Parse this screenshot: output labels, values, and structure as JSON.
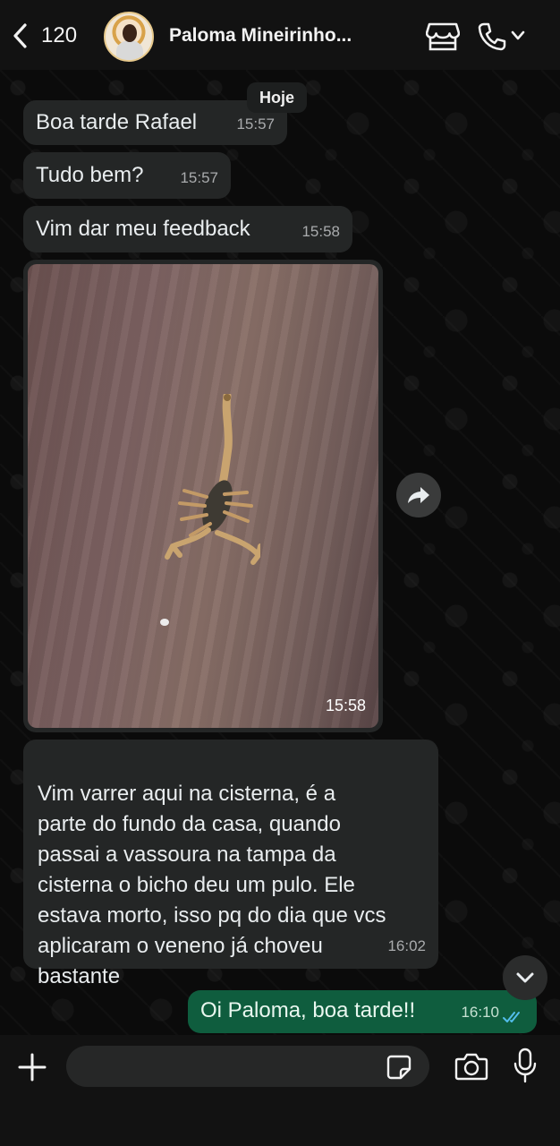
{
  "header": {
    "back_count": "120",
    "contact_name": "Paloma Mineirinho...",
    "icons": [
      "chevron-left-icon",
      "store-icon",
      "phone-icon",
      "chevron-down-icon"
    ]
  },
  "date_pill": "Hoje",
  "messages": [
    {
      "text": "Boa tarde Rafael",
      "time": "15:57",
      "direction": "incoming"
    },
    {
      "text": "Tudo bem?",
      "time": "15:57",
      "direction": "incoming"
    },
    {
      "text": "Vim dar meu feedback",
      "time": "15:58",
      "direction": "incoming"
    },
    {
      "type": "image",
      "time": "15:58",
      "direction": "incoming"
    },
    {
      "text": "Vim varrer aqui na cisterna,  é a\nparte do fundo da casa,  quando\npassai a vassoura na tampa da\ncisterna o bicho deu um pulo. Ele\nestava morto, isso pq do dia que vcs\naplicaram o veneno já choveu\nbastante",
      "time": "16:02",
      "direction": "incoming"
    },
    {
      "text": "Oi Paloma, boa tarde!!",
      "time": "16:10",
      "direction": "outgoing",
      "status": "read"
    }
  ],
  "composer": {
    "placeholder": ""
  },
  "colors": {
    "incoming_bubble": "#242626",
    "outgoing_bubble": "#0f5d3e",
    "read_ticks": "#53bdeb",
    "background": "#0b0b0b"
  }
}
